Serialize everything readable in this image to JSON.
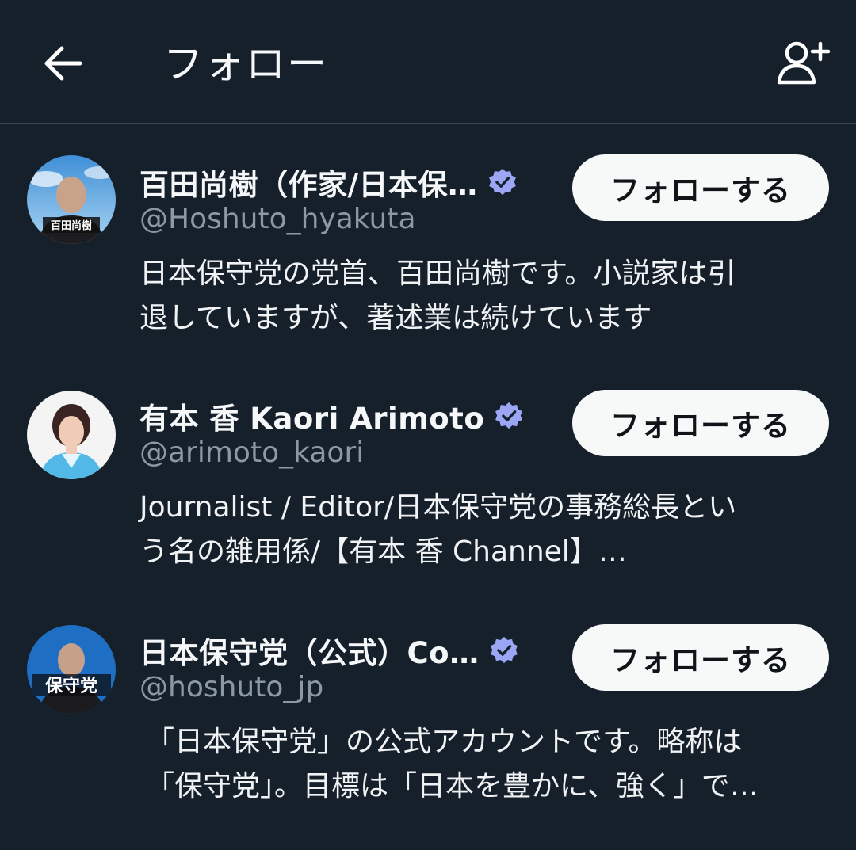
{
  "header": {
    "title": "フォロー",
    "back_icon": "arrow-left-icon",
    "add_user_icon": "person-plus-icon"
  },
  "colors": {
    "background": "#16202b",
    "verified": "#9ba7f5",
    "follow_button_bg": "#f7f9f9",
    "handle": "#8b98a5"
  },
  "users": [
    {
      "name": "百田尚樹（作家/日本保…",
      "handle": "@Hoshuto_hyakuta",
      "bio": "日本保守党の党首、百田尚樹です。小説家は引\n退していますが、著述業は続けています",
      "follow_label": "フォローする",
      "verified": true,
      "avatar_text": "百田尚樹"
    },
    {
      "name": "有本 香 Kaori Arimoto",
      "handle": "@arimoto_kaori",
      "bio": "Journalist / Editor/日本保守党の事務総長とい\nう名の雑用係/【有本 香 Channel】…",
      "follow_label": "フォローする",
      "verified": true
    },
    {
      "name": "日本保守党（公式）Co…",
      "handle": "@hoshuto_jp",
      "bio": "「日本保守党」の公式アカウントです。略称は\n「保守党」。目標は「日本を豊かに、強く」で…",
      "follow_label": "フォローする",
      "verified": true,
      "avatar_text": "保守党"
    }
  ]
}
